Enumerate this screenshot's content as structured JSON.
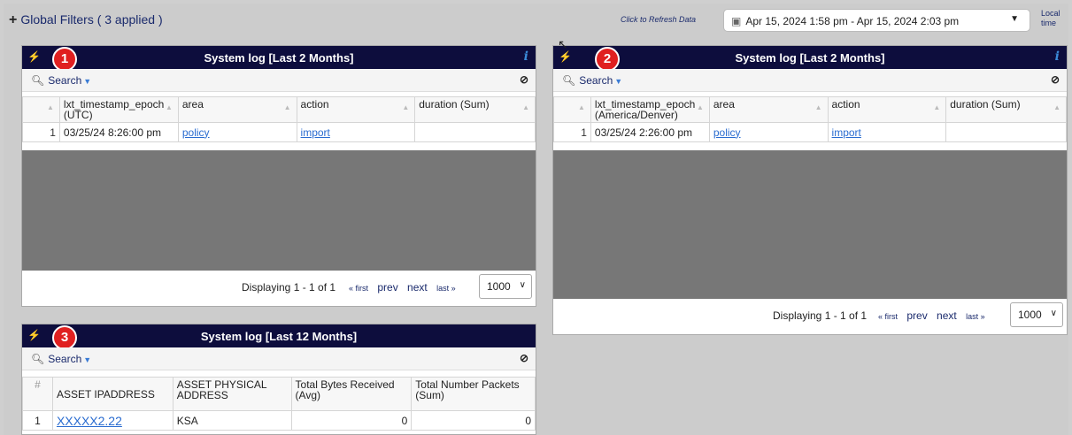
{
  "topbar": {
    "global_filters": "Global Filters ( 3 applied )",
    "refresh": "Click to Refresh Data",
    "date_range": "Apr 15, 2024 1:58 pm - Apr 15, 2024 2:03 pm",
    "local_time_line1": "Local",
    "local_time_line2": "time"
  },
  "colors": {
    "header_bg": "#0d0d3d",
    "badge": "#e02020",
    "link": "#2a6cd0",
    "empty_area": "#777777"
  },
  "panel1": {
    "badge": "1",
    "title": "System log [Last 2 Months]",
    "search": "Search",
    "columns": [
      "lxt_timestamp_epoch (UTC)",
      "area",
      "action",
      "duration (Sum)"
    ],
    "row": {
      "num": "1",
      "timestamp": "03/25/24 8:26:00 pm",
      "area": "policy",
      "action": "import",
      "duration": ""
    },
    "displaying": "Displaying 1 - 1 of 1",
    "first": "« first",
    "prev": "prev",
    "next": "next",
    "last": "last »",
    "page_size": "1000"
  },
  "panel2": {
    "badge": "2",
    "title": "System log [Last 2 Months]",
    "search": "Search",
    "columns": [
      "lxt_timestamp_epoch (America/Denver)",
      "area",
      "action",
      "duration (Sum)"
    ],
    "row": {
      "num": "1",
      "timestamp": "03/25/24 2:26:00 pm",
      "area": "policy",
      "action": "import",
      "duration": ""
    },
    "displaying": "Displaying 1 - 1 of 1",
    "first": "« first",
    "prev": "prev",
    "next": "next",
    "last": "last »",
    "page_size": "1000"
  },
  "panel3": {
    "badge": "3",
    "title": "System log [Last 12 Months]",
    "search": "Search",
    "columns": [
      "#",
      "ASSET IPADDRESS",
      "ASSET PHYSICAL ADDRESS",
      "Total Bytes Received (Avg)",
      "Total Number Packets (Sum)"
    ],
    "row": {
      "num": "1",
      "ip": "XXXXX2.22",
      "address": "KSA",
      "bytes": "0",
      "packets": "0"
    }
  }
}
